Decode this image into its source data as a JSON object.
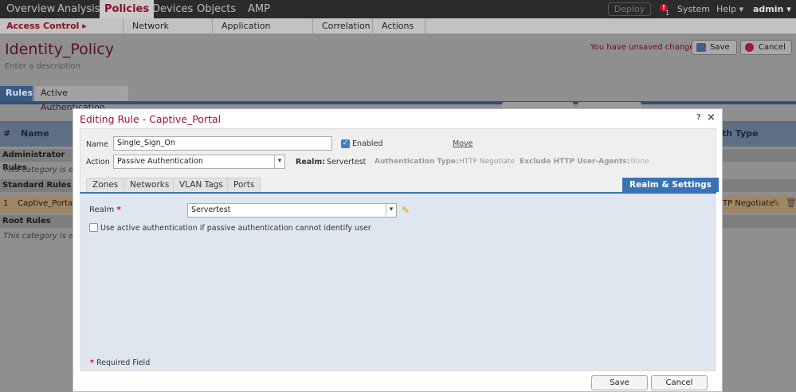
{
  "topnav": {
    "items": [
      {
        "label": "Overview"
      },
      {
        "label": "Analysis"
      },
      {
        "label": "Policies",
        "active": true
      },
      {
        "label": "Devices"
      },
      {
        "label": "Objects"
      },
      {
        "label": "AMP"
      }
    ],
    "deploy_label": "Deploy",
    "alert_count": "1",
    "system_label": "System",
    "help_label": "Help ▾",
    "user_label": "admin ▾"
  },
  "subnav": {
    "items": [
      {
        "label": "Access Control ▸ Identity",
        "active": true
      },
      {
        "label": "Network Discovery"
      },
      {
        "label": "Application Detectors"
      },
      {
        "label": "Correlation"
      },
      {
        "label": "Actions ▾"
      }
    ]
  },
  "policy": {
    "title": "Identity_Policy",
    "description_placeholder": "Enter a description",
    "unsaved_text": "You have unsaved changes",
    "save_label": "Save",
    "cancel_label": "Cancel"
  },
  "page_tabs": [
    {
      "label": "Rules",
      "active": true
    },
    {
      "label": "Active Authentication"
    }
  ],
  "rules_table": {
    "columns": [
      "#",
      "Name",
      "th Type"
    ],
    "categories": [
      {
        "label": "Administrator Rules",
        "empty": "This category is empty"
      },
      {
        "label": "Standard Rules"
      },
      {
        "label": "Root Rules",
        "empty": "This category is empty"
      }
    ],
    "rows": [
      {
        "index": "1",
        "name": "Captive_Portal",
        "auth_type": "TP Negotiate"
      }
    ]
  },
  "modal": {
    "title": "Editing Rule - Captive_Portal",
    "help_icon": "?",
    "close_icon": "×",
    "name_label": "Name",
    "name_value": "Single_Sign_On",
    "enabled_label": "Enabled",
    "enabled": true,
    "move_label": "Move",
    "action_label": "Action",
    "action_value": "Passive Authentication",
    "realm_info_label": "Realm:",
    "realm_info_value": "Servertest",
    "auth_type_label": "Authentication Type:",
    "auth_type_value": "HTTP Negotiate",
    "exclude_label": "Exclude HTTP User-Agents:",
    "exclude_value": "None",
    "tabs": [
      {
        "label": "Zones"
      },
      {
        "label": "Networks"
      },
      {
        "label": "VLAN Tags"
      },
      {
        "label": "Ports"
      },
      {
        "label": "Realm & Settings",
        "active": true
      }
    ],
    "realm_label": "Realm",
    "realm_value": "Servertest",
    "active_auth_label": "Use active authentication if passive authentication cannot identify user",
    "active_auth_checked": false,
    "required_note": "Required Field",
    "save_label": "Save",
    "cancel_label": "Cancel"
  },
  "colors": {
    "brand_red": "#8b0f24",
    "accent_blue": "#3a73b5",
    "nav_dark": "#2b2b2b"
  }
}
